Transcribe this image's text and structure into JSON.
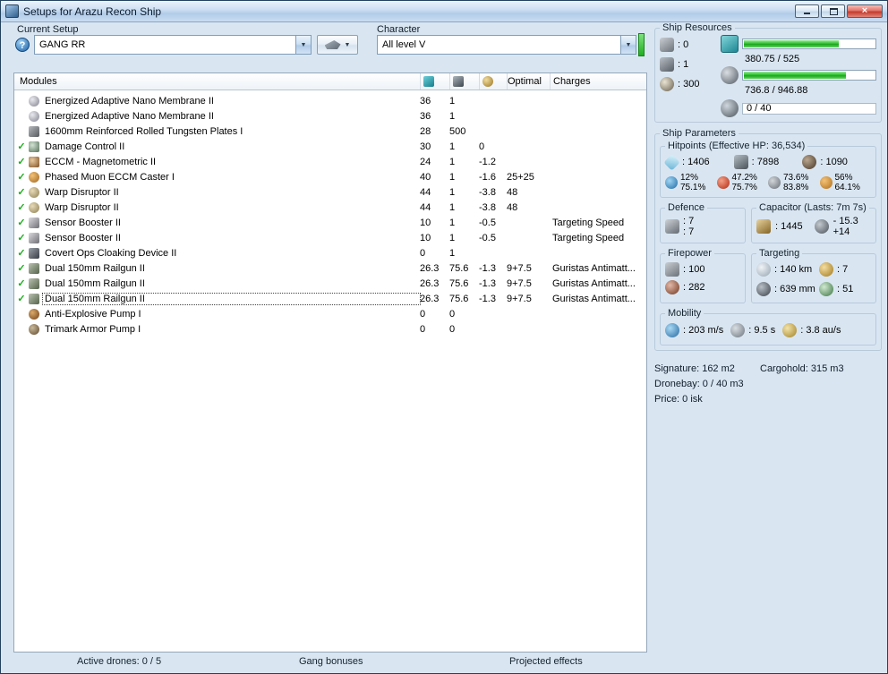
{
  "window": {
    "title": "Setups for Arazu Recon Ship"
  },
  "topbar": {
    "current_setup_label": "Current Setup",
    "current_setup_value": "GANG RR",
    "character_label": "Character",
    "character_value": "All level V"
  },
  "modules_table": {
    "header": {
      "name": "Modules",
      "optimal": "Optimal",
      "charges": "Charges"
    },
    "rows": [
      {
        "fitted": false,
        "icon": "armor-membrane-icon",
        "name": "Energized Adaptive Nano Membrane II",
        "cpu": "36",
        "pg": "1",
        "cap": "",
        "optimal": "",
        "charges": "",
        "selected": false
      },
      {
        "fitted": false,
        "icon": "armor-membrane-icon",
        "name": "Energized Adaptive Nano Membrane II",
        "cpu": "36",
        "pg": "1",
        "cap": "",
        "optimal": "",
        "charges": "",
        "selected": false
      },
      {
        "fitted": false,
        "icon": "armor-plate-icon",
        "name": "1600mm Reinforced Rolled Tungsten Plates I",
        "cpu": "28",
        "pg": "500",
        "cap": "",
        "optimal": "",
        "charges": "",
        "selected": false
      },
      {
        "fitted": true,
        "icon": "damage-control-icon",
        "name": "Damage Control II",
        "cpu": "30",
        "pg": "1",
        "cap": "0",
        "optimal": "",
        "charges": "",
        "selected": false
      },
      {
        "fitted": true,
        "icon": "eccm-icon",
        "name": "ECCM - Magnetometric II",
        "cpu": "24",
        "pg": "1",
        "cap": "-1.2",
        "optimal": "",
        "charges": "",
        "selected": false
      },
      {
        "fitted": true,
        "icon": "eccm-caster-icon",
        "name": "Phased Muon ECCM Caster I",
        "cpu": "40",
        "pg": "1",
        "cap": "-1.6",
        "optimal": "25+25",
        "charges": "",
        "selected": false
      },
      {
        "fitted": true,
        "icon": "warp-disruptor-icon",
        "name": "Warp Disruptor II",
        "cpu": "44",
        "pg": "1",
        "cap": "-3.8",
        "optimal": "48",
        "charges": "",
        "selected": false
      },
      {
        "fitted": true,
        "icon": "warp-disruptor-icon",
        "name": "Warp Disruptor II",
        "cpu": "44",
        "pg": "1",
        "cap": "-3.8",
        "optimal": "48",
        "charges": "",
        "selected": false
      },
      {
        "fitted": true,
        "icon": "sensor-booster-icon",
        "name": "Sensor Booster II",
        "cpu": "10",
        "pg": "1",
        "cap": "-0.5",
        "optimal": "",
        "charges": "Targeting Speed",
        "selected": false
      },
      {
        "fitted": true,
        "icon": "sensor-booster-icon",
        "name": "Sensor Booster II",
        "cpu": "10",
        "pg": "1",
        "cap": "-0.5",
        "optimal": "",
        "charges": "Targeting Speed",
        "selected": false
      },
      {
        "fitted": true,
        "icon": "cloak-icon",
        "name": "Covert Ops Cloaking Device II",
        "cpu": "0",
        "pg": "1",
        "cap": "",
        "optimal": "",
        "charges": "",
        "selected": false
      },
      {
        "fitted": true,
        "icon": "railgun-icon",
        "name": "Dual 150mm Railgun II",
        "cpu": "26.3",
        "pg": "75.6",
        "cap": "-1.3",
        "optimal": "9+7.5",
        "charges": "Guristas Antimatt...",
        "selected": false
      },
      {
        "fitted": true,
        "icon": "railgun-icon",
        "name": "Dual 150mm Railgun II",
        "cpu": "26.3",
        "pg": "75.6",
        "cap": "-1.3",
        "optimal": "9+7.5",
        "charges": "Guristas Antimatt...",
        "selected": false
      },
      {
        "fitted": true,
        "icon": "railgun-icon",
        "name": "Dual 150mm Railgun II",
        "cpu": "26.3",
        "pg": "75.6",
        "cap": "-1.3",
        "optimal": "9+7.5",
        "charges": "Guristas Antimatt...",
        "selected": true
      },
      {
        "fitted": false,
        "icon": "rig-anti-explosive-icon",
        "name": "Anti-Explosive Pump I",
        "cpu": "0",
        "pg": "0",
        "cap": "",
        "optimal": "",
        "charges": "",
        "selected": false
      },
      {
        "fitted": false,
        "icon": "rig-trimark-icon",
        "name": "Trimark Armor Pump I",
        "cpu": "0",
        "pg": "0",
        "cap": "",
        "optimal": "",
        "charges": "",
        "selected": false
      }
    ]
  },
  "footer": {
    "active_drones": "Active drones: 0 / 5",
    "gang_bonuses": "Gang bonuses",
    "projected_effects": "Projected effects"
  },
  "ship_resources": {
    "title": "Ship Resources",
    "turrets": ": 0",
    "launchers": ": 1",
    "calibration": ": 300",
    "cpu_text": "380.75 / 525",
    "cpu_pct": 72.5,
    "pg_text": "736.8 / 946.88",
    "pg_pct": 77.8,
    "drone_text": "0 / 40"
  },
  "ship_parameters": {
    "title": "Ship Parameters",
    "hitpoints": {
      "title": "Hitpoints (Effective HP: 36,534)",
      "shield": ": 1406",
      "armor": ": 7898",
      "structure": ": 1090",
      "resists": [
        {
          "icon": "em-resist-icon",
          "top": "12%",
          "bottom": "75.1%"
        },
        {
          "icon": "thermal-resist-icon",
          "top": "47.2%",
          "bottom": "75.7%"
        },
        {
          "icon": "kinetic-resist-icon",
          "top": "73.6%",
          "bottom": "83.8%"
        },
        {
          "icon": "explosive-resist-icon",
          "top": "56%",
          "bottom": "64.1%"
        }
      ]
    },
    "defence": {
      "title": "Defence",
      "top": ": 7",
      "bottom": ": 7"
    },
    "capacitor": {
      "title": "Capacitor (Lasts: 7m 7s)",
      "amount": ": 1445",
      "delta_top": "- 15.3",
      "delta_bottom": "+14"
    },
    "firepower": {
      "title": "Firepower",
      "volley": ": 100",
      "dps": ": 282"
    },
    "targeting": {
      "title": "Targeting",
      "range": ": 140 km",
      "max_targets": ": 7",
      "scan_res": ": 639 mm",
      "sensor_strength": ": 51"
    },
    "mobility": {
      "title": "Mobility",
      "speed": ": 203 m/s",
      "agility": ": 9.5 s",
      "warp": ": 3.8 au/s"
    },
    "signature": "Signature: 162 m2",
    "cargohold": "Cargohold: 315 m3",
    "dronebay": "Dronebay: 0 / 40 m3",
    "price": "Price: 0 isk"
  },
  "icon_names": [
    "app-icon",
    "minimize-icon",
    "maximize-icon",
    "close-icon",
    "help-icon",
    "ship-selector-icon",
    "dropdown-arrow-icon",
    "cpu-column-icon",
    "powergrid-column-icon",
    "capacitor-column-icon",
    "fitted-check-icon",
    "turret-hardpoints-icon",
    "launcher-hardpoints-icon",
    "calibration-icon",
    "cpu-icon",
    "powergrid-icon",
    "drone-bandwidth-icon",
    "shield-hp-icon",
    "armor-hp-icon",
    "structure-hp-icon",
    "tank-icon",
    "capacitor-icon",
    "cap-recharge-icon",
    "volley-icon",
    "dps-icon",
    "range-icon",
    "max-targets-icon",
    "scan-res-icon",
    "sensor-strength-icon",
    "speed-icon",
    "agility-icon",
    "warp-speed-icon"
  ]
}
